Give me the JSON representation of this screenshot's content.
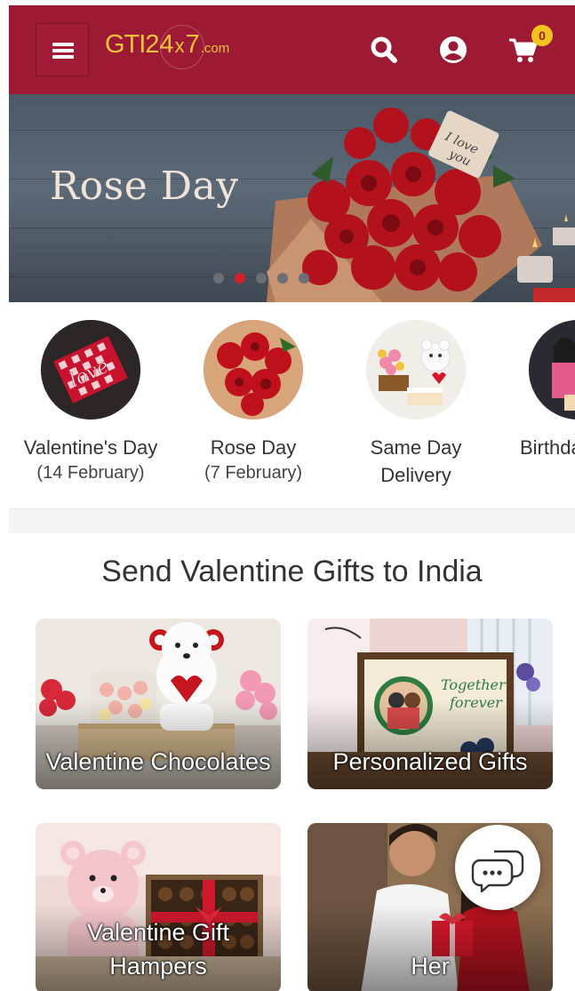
{
  "header": {
    "logo": {
      "gti": "GTI",
      "num": "24",
      "x": "x",
      "seven": "7",
      "dotcom": ".com"
    },
    "cart_count": "0",
    "colors": {
      "primary": "#9c1a33",
      "logo": "#f3c23c",
      "badge": "#f4c21f"
    },
    "icons": [
      "menu-icon",
      "search-icon",
      "user-icon",
      "cart-icon"
    ]
  },
  "banner": {
    "title": "Rose Day",
    "slides": 5,
    "active_slide": 2
  },
  "categories": [
    {
      "label": "Valentine's Day",
      "sub": "(14 February)"
    },
    {
      "label": "Rose Day",
      "sub": "(7 February)"
    },
    {
      "label": "Same Day Delivery",
      "sub": ""
    },
    {
      "label": "Birthday Gifts",
      "sub": ""
    }
  ],
  "section": {
    "title": "Send Valentine Gifts to India",
    "tiles": [
      {
        "label": "Valentine Chocolates"
      },
      {
        "label": "Personalized Gifts"
      },
      {
        "label": "Valentine Gift Hampers"
      },
      {
        "label": "Her"
      }
    ]
  },
  "chat": {
    "icon": "chat-icon"
  }
}
